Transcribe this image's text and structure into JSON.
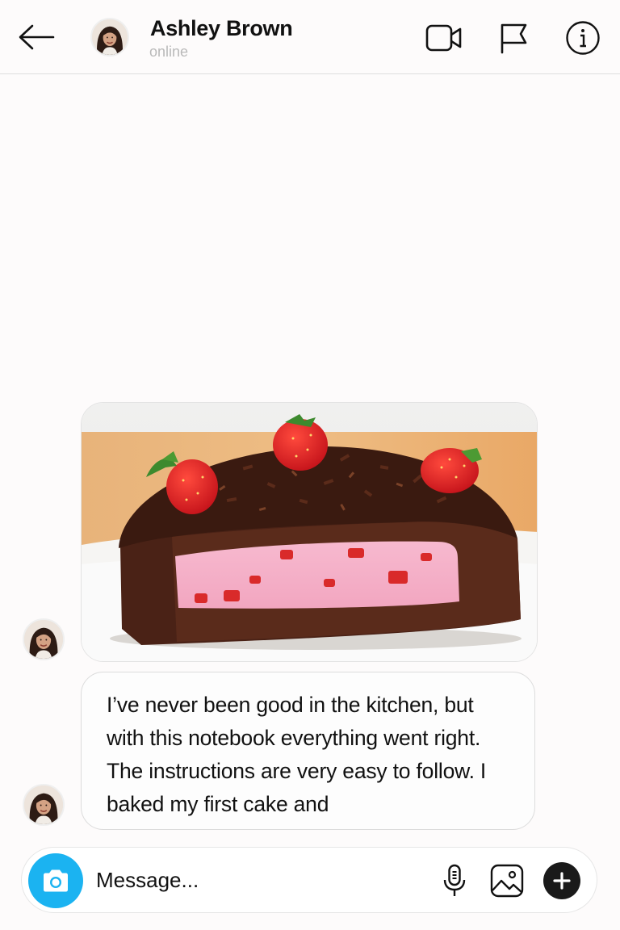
{
  "header": {
    "contact_name": "Ashley Brown",
    "status": "online",
    "icons": {
      "back": "arrow-left-icon",
      "video": "video-camera-icon",
      "report": "flag-icon",
      "info": "info-icon"
    }
  },
  "conversation": {
    "messages": [
      {
        "type": "image",
        "content": "chocolate cake with strawberry cream filling topped with strawberries"
      },
      {
        "type": "text",
        "text": "I’ve never been good in the kitchen, but with this notebook everything went right. The instructions are very easy to follow. I baked my first cake and"
      }
    ]
  },
  "composer": {
    "placeholder": "Message...",
    "icons": {
      "camera": "camera-icon",
      "mic": "microphone-icon",
      "gallery": "image-icon",
      "more": "plus-icon"
    }
  },
  "colors": {
    "camera_button": "#1bb3f1",
    "plus_button": "#1a1a1a",
    "status_text": "#b9b9b9",
    "divider": "#dedede"
  }
}
